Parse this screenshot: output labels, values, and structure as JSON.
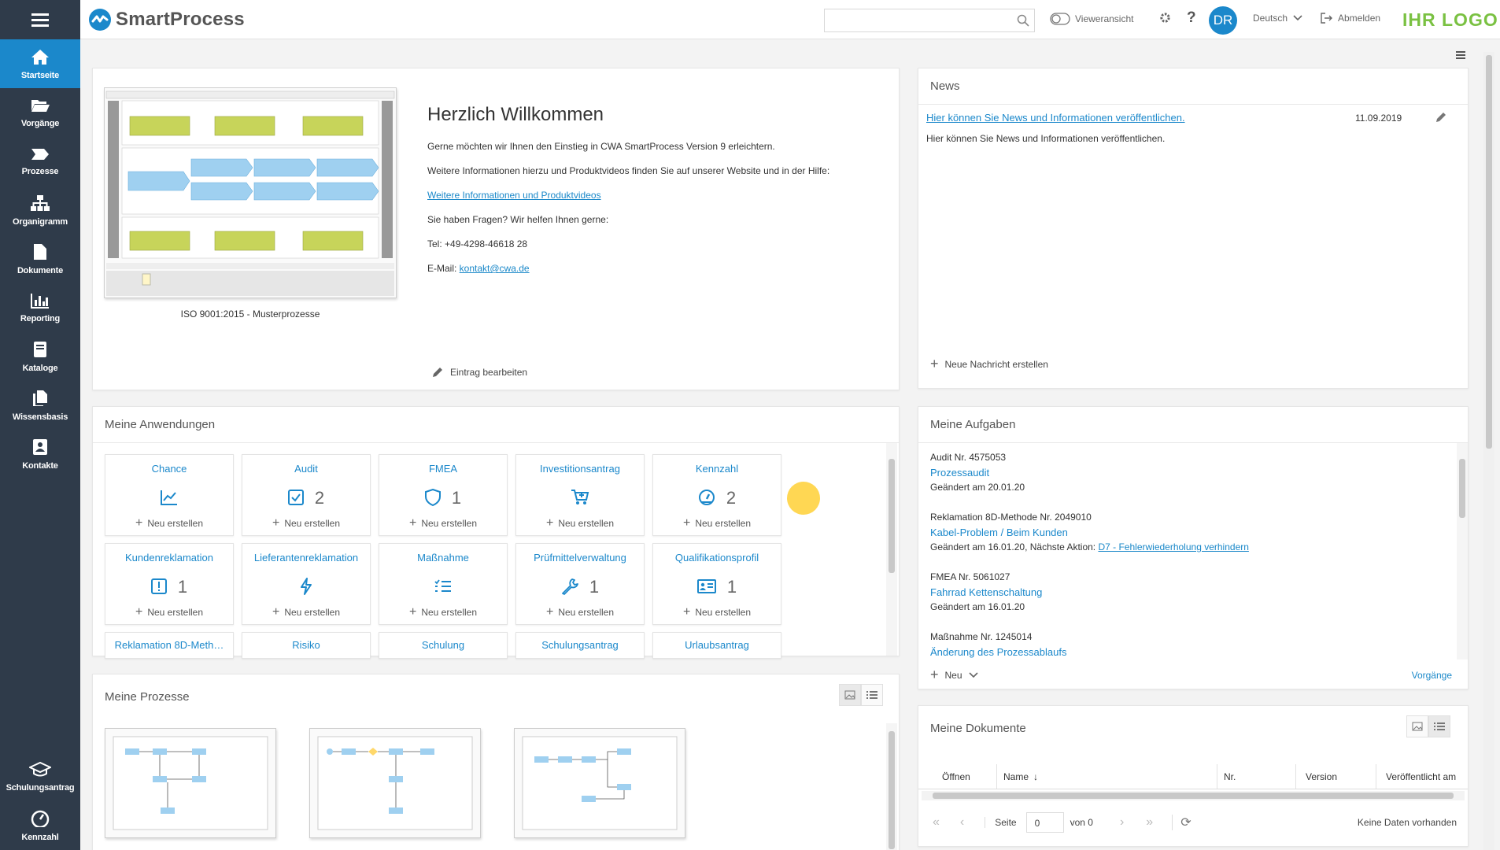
{
  "app": {
    "name": "SmartProcess",
    "brand_color": "#1b88cb",
    "sidebar_color": "#2f3b4a",
    "customer_logo": "IHR LOGO"
  },
  "sidebar": {
    "items": [
      {
        "label": "Startseite",
        "icon": "home-icon",
        "active": true
      },
      {
        "label": "Vorgänge",
        "icon": "folder-open-icon"
      },
      {
        "label": "Prozesse",
        "icon": "process-icon"
      },
      {
        "label": "Organigramm",
        "icon": "org-chart-icon"
      },
      {
        "label": "Dokumente",
        "icon": "document-icon"
      },
      {
        "label": "Reporting",
        "icon": "bar-chart-icon"
      },
      {
        "label": "Kataloge",
        "icon": "book-icon"
      },
      {
        "label": "Wissensbasis",
        "icon": "files-icon"
      },
      {
        "label": "Kontakte",
        "icon": "contact-icon"
      }
    ],
    "bottom": [
      {
        "label": "Schulungsantrag",
        "icon": "graduation-cap-icon"
      },
      {
        "label": "Kennzahl",
        "icon": "gauge-icon"
      }
    ]
  },
  "header": {
    "search_placeholder": "",
    "view_toggle": "Vieweransicht",
    "avatar_initials": "DR",
    "language": "Deutsch",
    "logout": "Abmelden"
  },
  "welcome": {
    "image_caption": "ISO 9001:2015 - Musterprozesse",
    "title": "Herzlich Willkommen",
    "p1": "Gerne möchten wir Ihnen den Einstieg in CWA SmartProcess Version 9 erleichtern.",
    "p2": "Weitere Informationen hierzu und Produktvideos finden Sie auf unserer Website und in der Hilfe:",
    "link": "Weitere Informationen und Produktvideos",
    "p3": "Sie haben Fragen? Wir helfen Ihnen gerne:",
    "phone": "Tel: +49-4298-46618 28",
    "email_label": "E-Mail: ",
    "email": "kontakt@cwa.de",
    "edit": "Eintrag bearbeiten"
  },
  "news": {
    "title": "News",
    "item_title": "Hier können Sie News und Informationen veröffentlichen.",
    "item_date": "11.09.2019",
    "item_body": "Hier können Sie News und Informationen veröffentlichen.",
    "add": "Neue Nachricht erstellen"
  },
  "apps": {
    "title": "Meine Anwendungen",
    "new_label": "Neu erstellen",
    "tiles": [
      {
        "name": "Chance",
        "icon": "chart-line-icon",
        "count": ""
      },
      {
        "name": "Audit",
        "icon": "checkbox-icon",
        "count": "2"
      },
      {
        "name": "FMEA",
        "icon": "shield-icon",
        "count": "1"
      },
      {
        "name": "Investitionsantrag",
        "icon": "cart-icon",
        "count": ""
      },
      {
        "name": "Kennzahl",
        "icon": "gauge-icon",
        "count": "2"
      },
      {
        "name": "Kundenreklamation",
        "icon": "exclamation-icon",
        "count": "1"
      },
      {
        "name": "Lieferantenreklamation",
        "icon": "bolt-icon",
        "count": ""
      },
      {
        "name": "Maßnahme",
        "icon": "list-icon",
        "count": ""
      },
      {
        "name": "Prüfmittelverwaltung",
        "icon": "wrench-icon",
        "count": "1"
      },
      {
        "name": "Qualifikationsprofil",
        "icon": "id-card-icon",
        "count": "1"
      }
    ],
    "row3": [
      "Reklamation 8D-Meth…",
      "Risiko",
      "Schulung",
      "Schulungsantrag",
      "Urlaubsantrag"
    ]
  },
  "tasks": {
    "title": "Meine Aufgaben",
    "items": [
      {
        "id": "Audit Nr. 4575053",
        "link": "Prozessaudit",
        "changed": "Geändert am 20.01.20",
        "next_label": "",
        "next_link": ""
      },
      {
        "id": "Reklamation 8D-Methode Nr. 2049010",
        "link": "Kabel-Problem / Beim Kunden",
        "changed": "Geändert am 16.01.20, Nächste Aktion: ",
        "next_label": "",
        "next_link": "D7 - Fehlerwiederholung verhindern"
      },
      {
        "id": "FMEA Nr. 5061027",
        "link": "Fahrrad Kettenschaltung",
        "changed": "Geändert am 16.01.20",
        "next_label": "",
        "next_link": ""
      },
      {
        "id": "Maßnahme Nr. 1245014",
        "link": "Änderung des Prozessablaufs",
        "changed": "",
        "next_label": "",
        "next_link": ""
      }
    ],
    "new": "Neu",
    "all_link": "Vorgänge"
  },
  "processes": {
    "title": "Meine Prozesse"
  },
  "documents": {
    "title": "Meine Dokumente",
    "columns": [
      "Öffnen",
      "Name",
      "Nr.",
      "Version",
      "Veröffentlicht am"
    ],
    "page_label": "Seite",
    "page_value": "0",
    "of_label": "von 0",
    "empty": "Keine Daten vorhanden"
  }
}
